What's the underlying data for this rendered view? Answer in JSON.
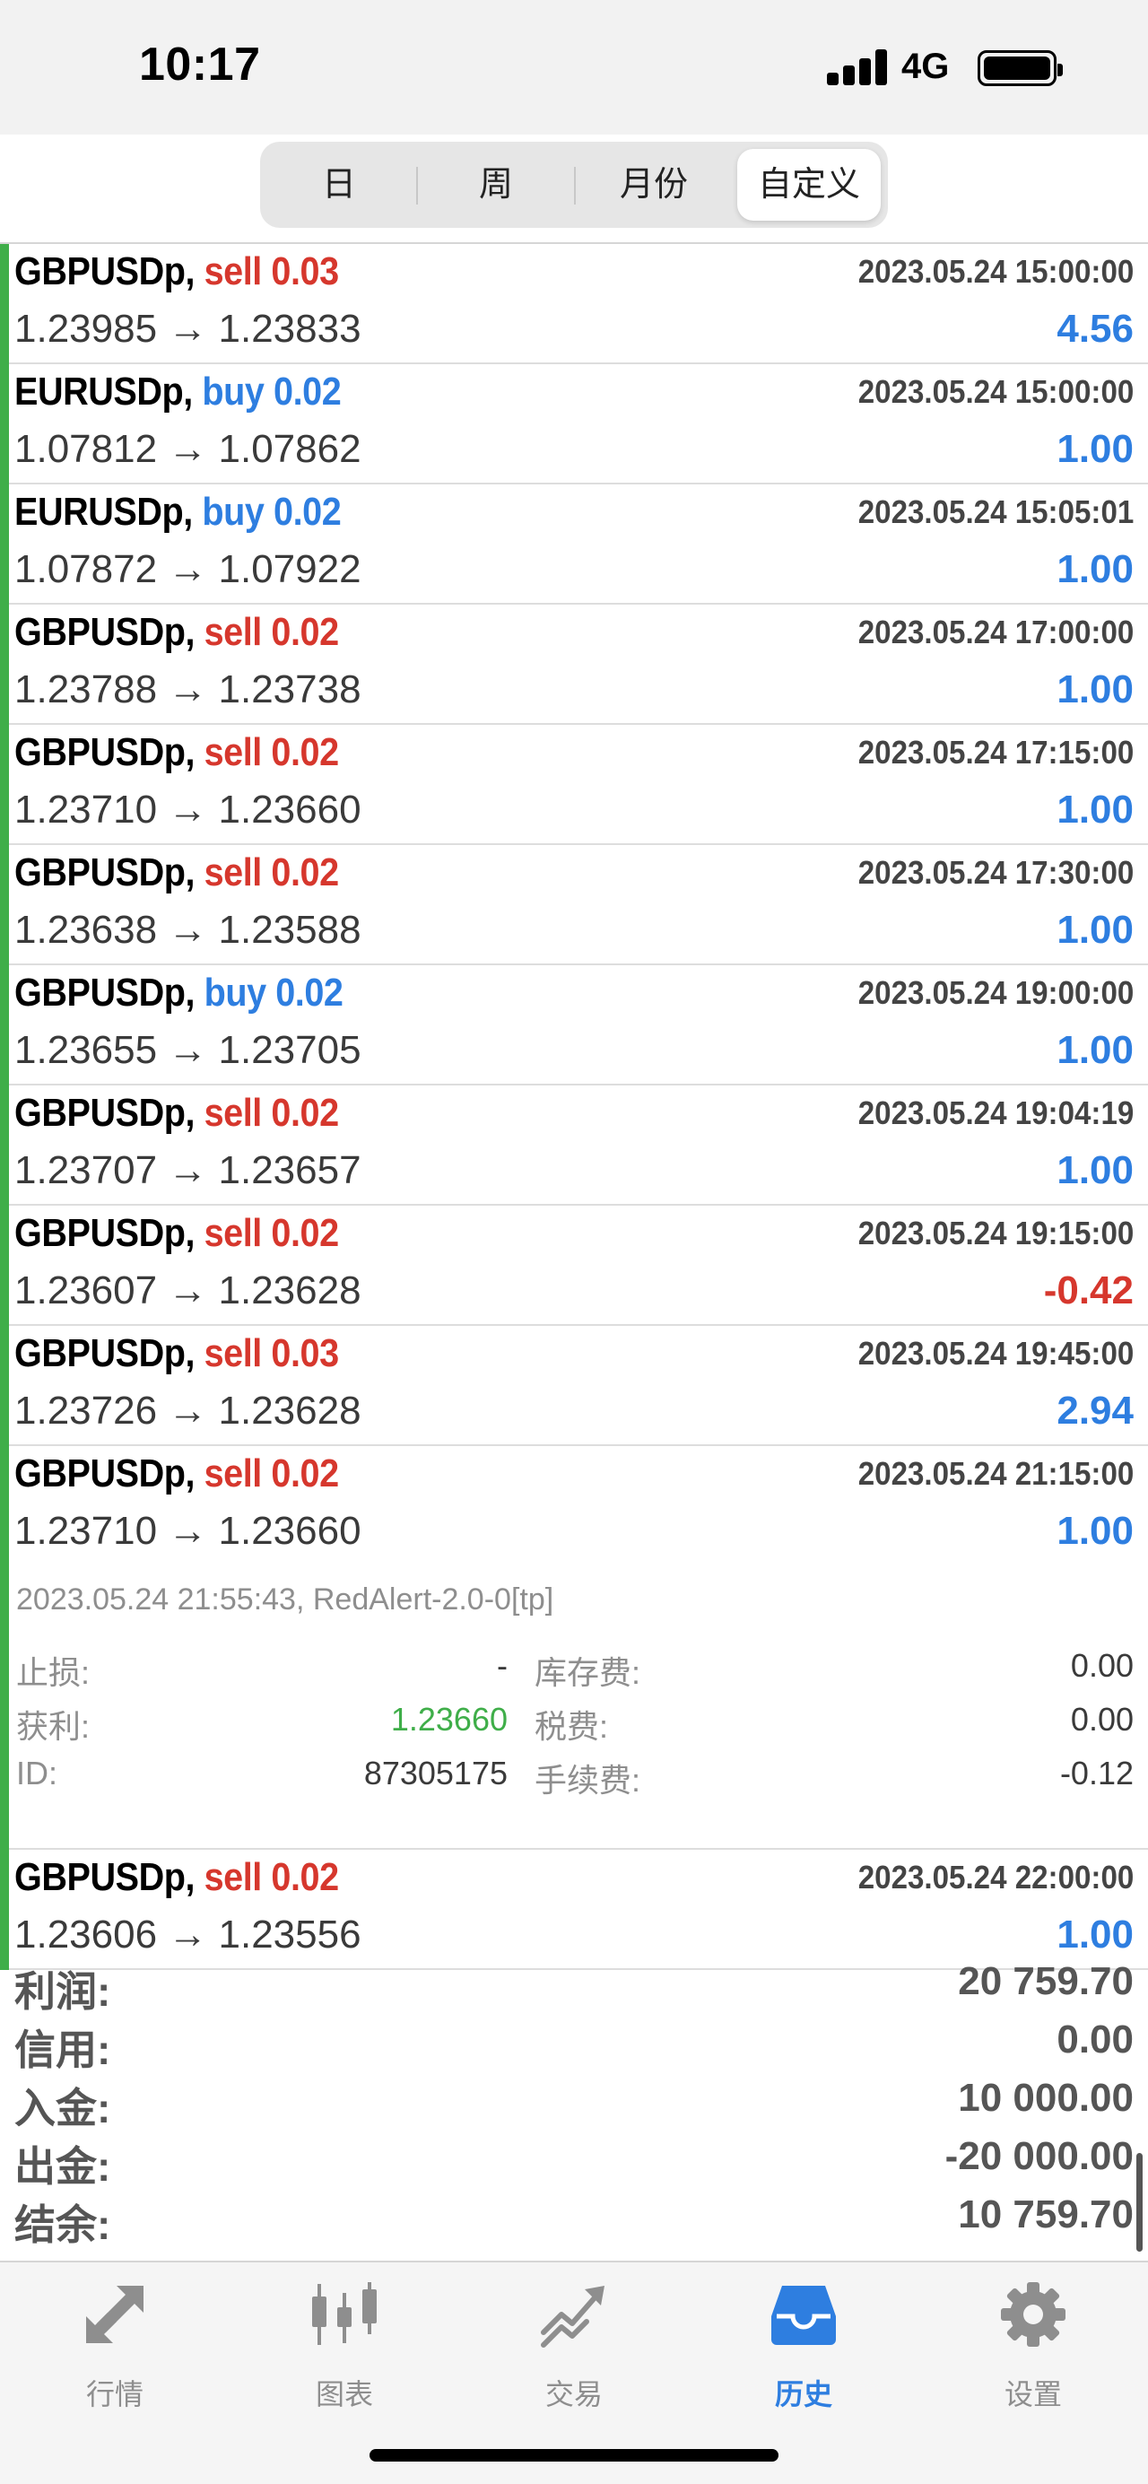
{
  "status_bar": {
    "time": "10:17",
    "network": "4G"
  },
  "segments": [
    {
      "label": "日",
      "active": false
    },
    {
      "label": "周",
      "active": false
    },
    {
      "label": "月份",
      "active": false
    },
    {
      "label": "自定义",
      "active": true
    }
  ],
  "deals": [
    {
      "symbol": "GBPUSDp,",
      "side": "sell",
      "volume": "0.03",
      "time": "2023.05.24 15:00:00",
      "prices": "1.23985 → 1.23833",
      "profit": "4.56"
    },
    {
      "symbol": "EURUSDp,",
      "side": "buy",
      "volume": "0.02",
      "time": "2023.05.24 15:00:00",
      "prices": "1.07812 → 1.07862",
      "profit": "1.00"
    },
    {
      "symbol": "EURUSDp,",
      "side": "buy",
      "volume": "0.02",
      "time": "2023.05.24 15:05:01",
      "prices": "1.07872 → 1.07922",
      "profit": "1.00"
    },
    {
      "symbol": "GBPUSDp,",
      "side": "sell",
      "volume": "0.02",
      "time": "2023.05.24 17:00:00",
      "prices": "1.23788 → 1.23738",
      "profit": "1.00"
    },
    {
      "symbol": "GBPUSDp,",
      "side": "sell",
      "volume": "0.02",
      "time": "2023.05.24 17:15:00",
      "prices": "1.23710 → 1.23660",
      "profit": "1.00"
    },
    {
      "symbol": "GBPUSDp,",
      "side": "sell",
      "volume": "0.02",
      "time": "2023.05.24 17:30:00",
      "prices": "1.23638 → 1.23588",
      "profit": "1.00"
    },
    {
      "symbol": "GBPUSDp,",
      "side": "buy",
      "volume": "0.02",
      "time": "2023.05.24 19:00:00",
      "prices": "1.23655 → 1.23705",
      "profit": "1.00"
    },
    {
      "symbol": "GBPUSDp,",
      "side": "sell",
      "volume": "0.02",
      "time": "2023.05.24 19:04:19",
      "prices": "1.23707 → 1.23657",
      "profit": "1.00"
    },
    {
      "symbol": "GBPUSDp,",
      "side": "sell",
      "volume": "0.02",
      "time": "2023.05.24 19:15:00",
      "prices": "1.23607 → 1.23628",
      "profit": "-0.42"
    },
    {
      "symbol": "GBPUSDp,",
      "side": "sell",
      "volume": "0.03",
      "time": "2023.05.24 19:45:00",
      "prices": "1.23726 → 1.23628",
      "profit": "2.94"
    },
    {
      "symbol": "GBPUSDp,",
      "side": "sell",
      "volume": "0.02",
      "time": "2023.05.24 21:15:00",
      "prices": "1.23710 → 1.23660",
      "profit": "1.00",
      "details": {
        "comment": "2023.05.24 21:55:43, RedAlert-2.0-0[tp]",
        "stop_loss_label": "止损:",
        "stop_loss": "-",
        "swap_label": "库存费:",
        "swap": "0.00",
        "take_profit_label": "获利:",
        "take_profit": "1.23660",
        "tax_label": "税费:",
        "tax": "0.00",
        "id_label": "ID:",
        "id": "87305175",
        "commission_label": "手续费:",
        "commission": "-0.12"
      }
    },
    {
      "symbol": "GBPUSDp,",
      "side": "sell",
      "volume": "0.02",
      "time": "2023.05.24 22:00:00",
      "prices": "1.23606 → 1.23556",
      "profit": "1.00"
    }
  ],
  "summary": [
    {
      "label": "利润:",
      "value": "20 759.70"
    },
    {
      "label": "信用:",
      "value": "0.00"
    },
    {
      "label": "入金:",
      "value": "10 000.00"
    },
    {
      "label": "出金:",
      "value": "-20 000.00"
    },
    {
      "label": "结余:",
      "value": "10 759.70"
    }
  ],
  "tabs": [
    {
      "label": "行情",
      "icon": "quotes-arrows-icon",
      "active": false
    },
    {
      "label": "图表",
      "icon": "candlestick-chart-icon",
      "active": false
    },
    {
      "label": "交易",
      "icon": "trade-trend-icon",
      "active": false
    },
    {
      "label": "历史",
      "icon": "history-inbox-icon",
      "active": true
    },
    {
      "label": "设置",
      "icon": "gear-icon",
      "active": false
    }
  ],
  "colors": {
    "sell": "#d6372d",
    "buy": "#2e7ee0",
    "accent_bar": "#3fae49",
    "active_tab": "#2e7ee0"
  }
}
